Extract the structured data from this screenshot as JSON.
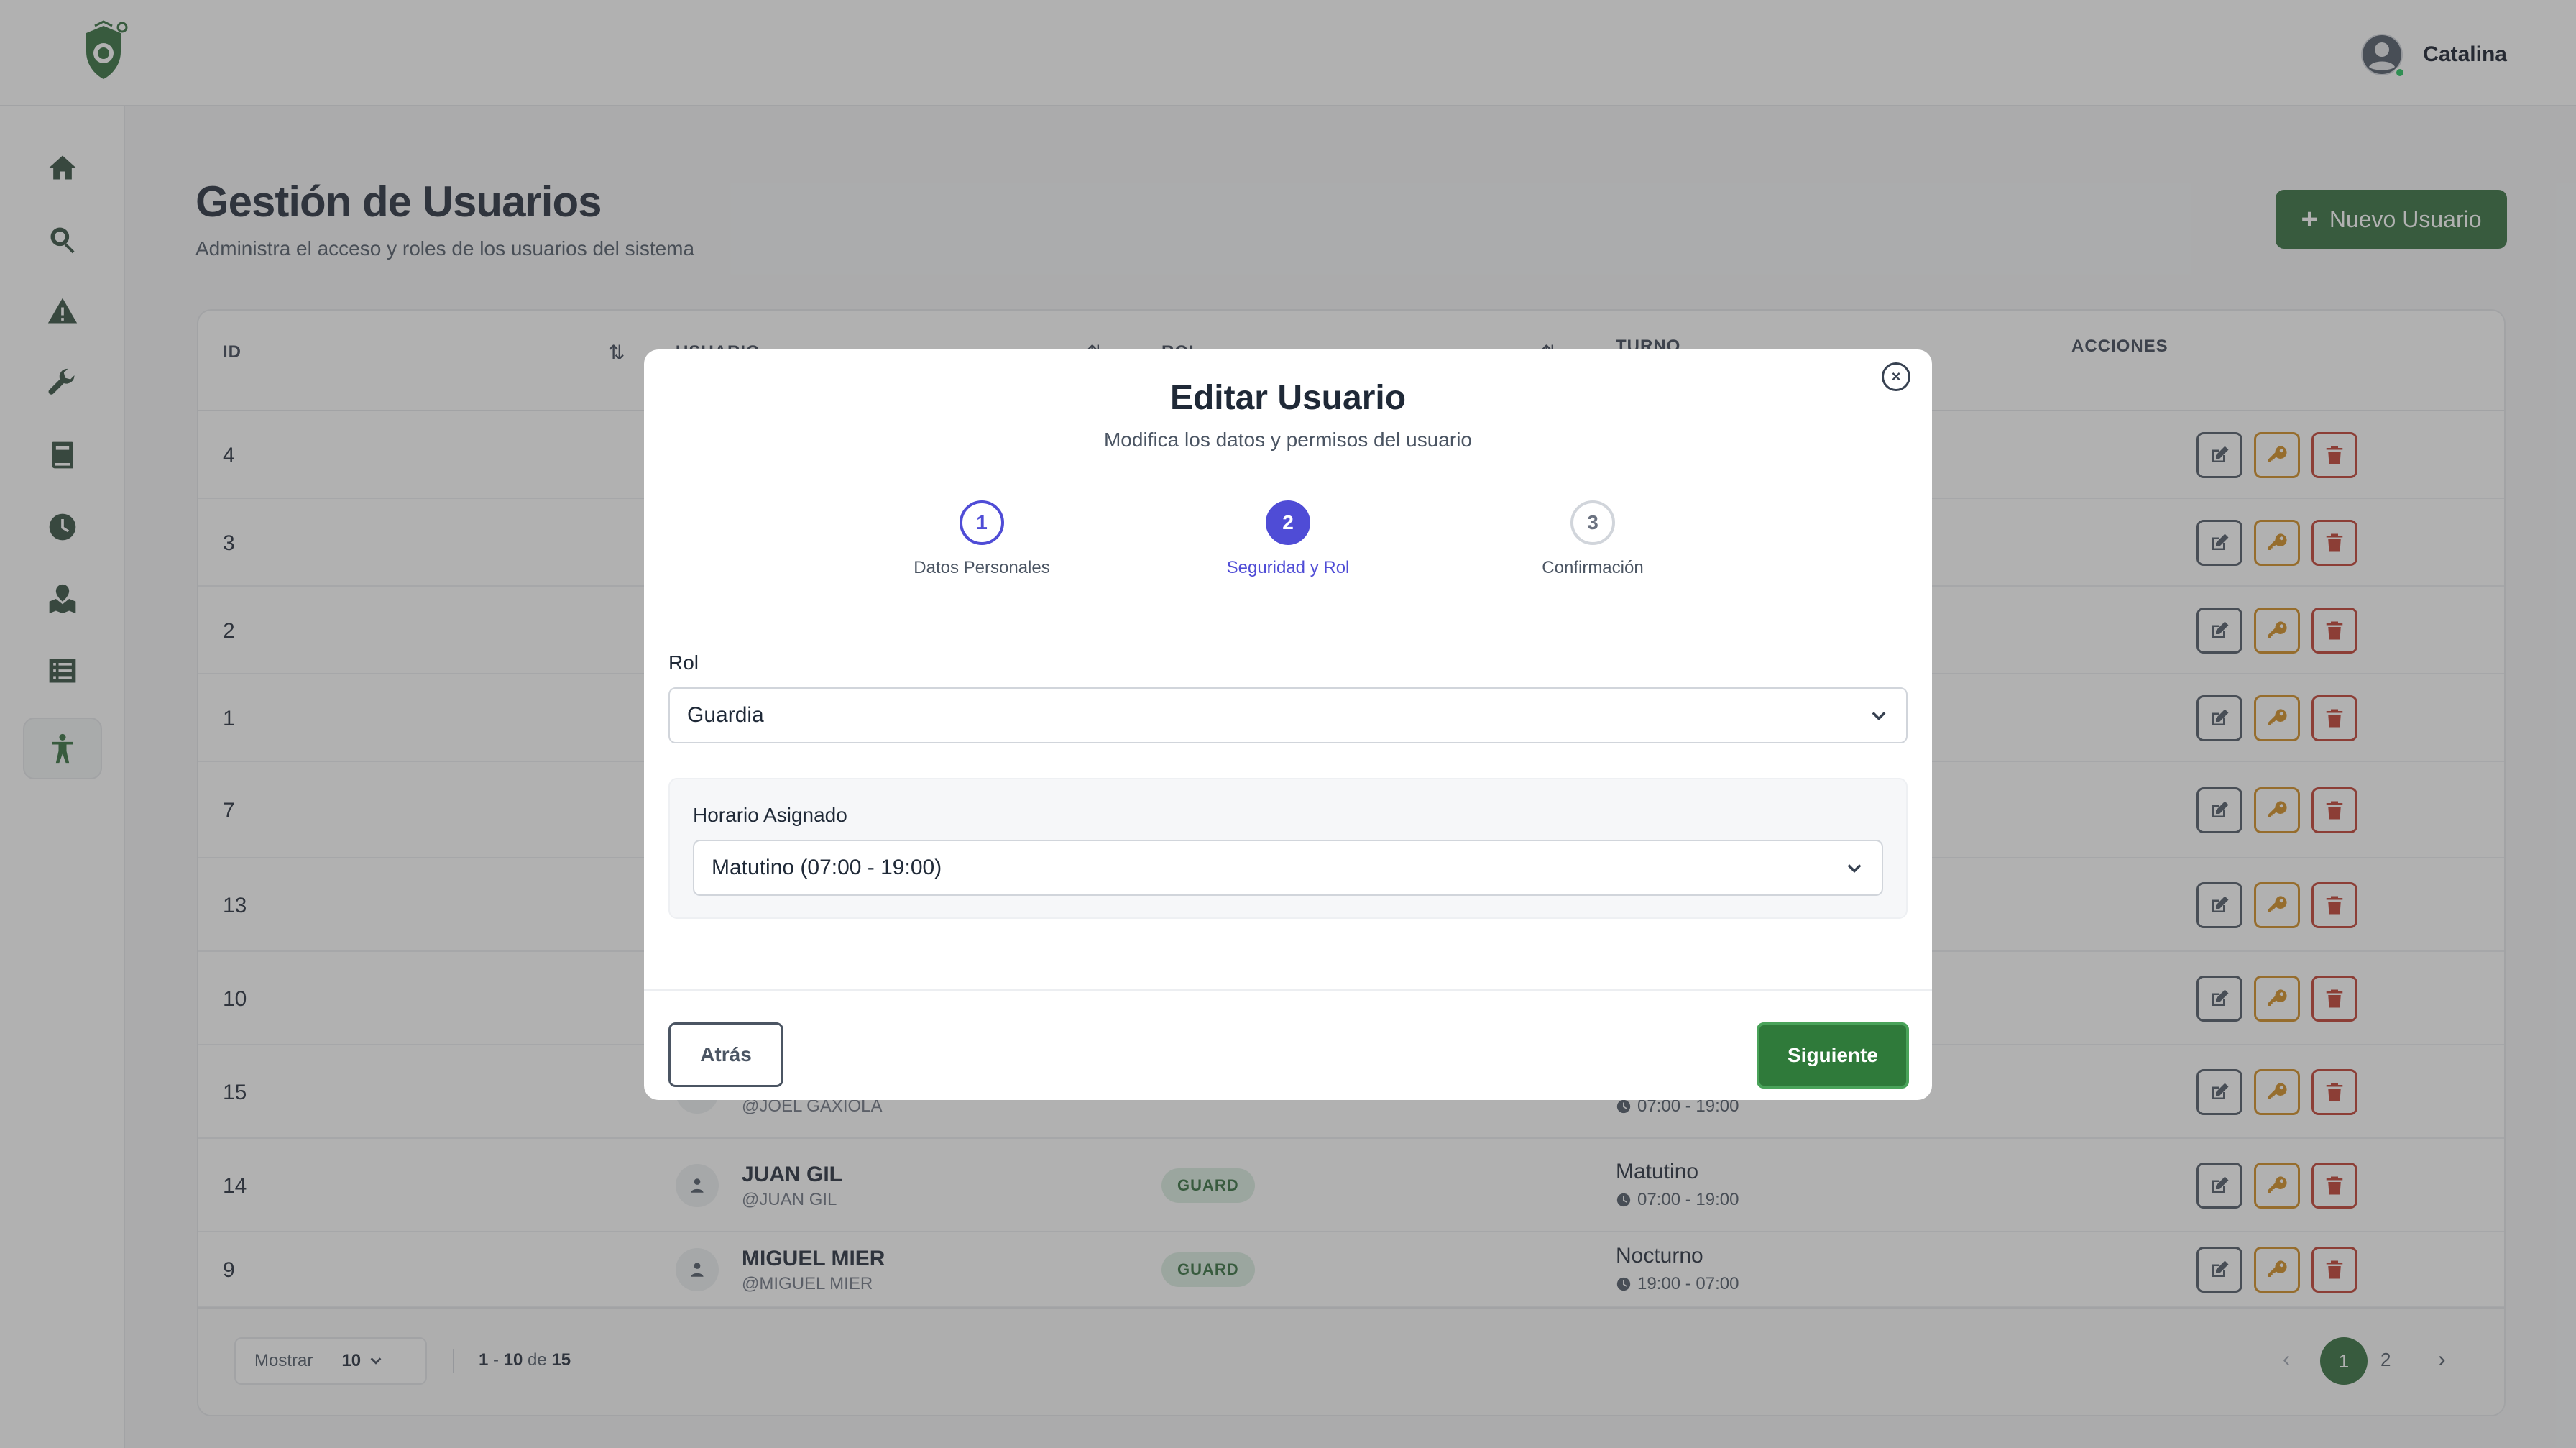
{
  "header": {
    "user_name": "Catalina"
  },
  "page": {
    "title": "Gestión de Usuarios",
    "subtitle": "Administra el acceso y roles de los usuarios del sistema",
    "new_user_plus": "+",
    "new_user_label": "Nuevo Usuario"
  },
  "table": {
    "headers": {
      "id": "ID",
      "usuario": "USUARIO",
      "rol": "ROL",
      "turno": "TURNO",
      "acciones": "ACCIONES"
    },
    "sort_glyph": "⇅",
    "rows": [
      {
        "id": "4"
      },
      {
        "id": "3"
      },
      {
        "id": "2"
      },
      {
        "id": "1"
      },
      {
        "id": "7"
      },
      {
        "id": "13"
      },
      {
        "id": "10"
      },
      {
        "id": "15",
        "handle": "@JOEL GAXIOLA",
        "shift_time": "07:00 - 19:00"
      },
      {
        "id": "14",
        "name": "JUAN GIL",
        "handle": "@JUAN GIL",
        "role": "GUARD",
        "shift": "Matutino",
        "shift_time": "07:00 - 19:00"
      },
      {
        "id": "9",
        "name": "MIGUEL MIER",
        "handle": "@MIGUEL MIER",
        "role": "GUARD",
        "shift": "Nocturno",
        "shift_time": "19:00 - 07:00"
      }
    ],
    "footer": {
      "show_label": "Mostrar",
      "page_size": "10",
      "range_start": "1",
      "range_dash": " - ",
      "range_end": "10",
      "range_of": " de ",
      "total": "15",
      "prev": "‹",
      "page_1": "1",
      "page_2": "2",
      "next": "›"
    }
  },
  "modal": {
    "title": "Editar Usuario",
    "subtitle": "Modifica los datos y permisos del usuario",
    "close_glyph": "×",
    "steps": [
      {
        "number": "1",
        "label": "Datos Personales",
        "state": "done"
      },
      {
        "number": "2",
        "label": "Seguridad y Rol",
        "state": "active"
      },
      {
        "number": "3",
        "label": "Confirmación",
        "state": "todo"
      }
    ],
    "role_label": "Rol",
    "role_value": "Guardia",
    "schedule_label": "Horario Asignado",
    "schedule_value": "Matutino (07:00 - 19:00)",
    "back_label": "Atrás",
    "next_label": "Siguiente"
  },
  "colors": {
    "brand_green": "#2f6b3a",
    "step_indigo": "#4f4cd6",
    "role_badge_bg": "#d9ece0",
    "edit_border": "#4b5563",
    "key_border": "#d08a1c",
    "delete_border": "#c0392b"
  },
  "icons": {
    "sidebar": [
      "home-icon",
      "search-icon",
      "alert-icon",
      "wrench-icon",
      "book-icon",
      "clock-icon",
      "map-icon",
      "list-icon",
      "person-icon"
    ],
    "actions": [
      "edit-icon",
      "key-icon",
      "trash-icon"
    ]
  }
}
